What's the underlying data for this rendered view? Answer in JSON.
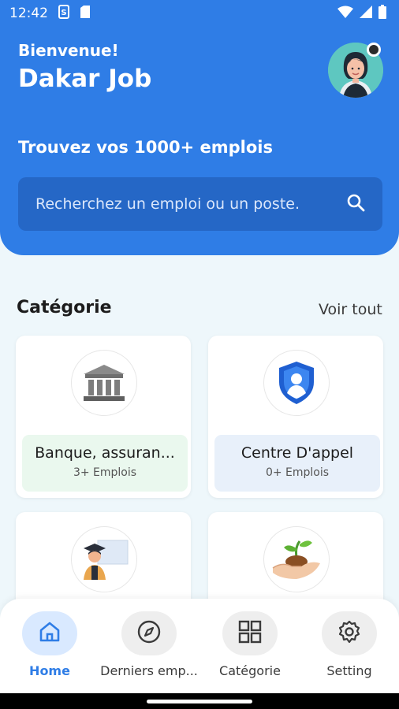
{
  "status_bar": {
    "time": "12:42"
  },
  "header": {
    "welcome": "Bienvenue!",
    "app_title": "Dakar Job",
    "tagline": "Trouvez vos 1000+ emplois",
    "search_placeholder": "Recherchez un emploi ou un poste."
  },
  "categories_section": {
    "title": "Catégorie",
    "see_all": "Voir tout",
    "cards": [
      {
        "name": "Banque, assuran...",
        "count": "3+ Emplois",
        "icon": "bank-icon",
        "bg": "#eaf8ee"
      },
      {
        "name": "Centre D'appel",
        "count": "0+ Emplois",
        "icon": "shield-user-icon",
        "bg": "#e8f0fa"
      },
      {
        "name": "",
        "count": "",
        "icon": "teacher-icon",
        "bg": "#ffffff"
      },
      {
        "name": "",
        "count": "",
        "icon": "plant-hand-icon",
        "bg": "#ffffff"
      }
    ]
  },
  "bottom_nav": {
    "items": [
      {
        "label": "Home",
        "icon": "home-icon",
        "active": true
      },
      {
        "label": "Derniers emp...",
        "icon": "compass-icon",
        "active": false
      },
      {
        "label": "Catégorie",
        "icon": "grid-icon",
        "active": false
      },
      {
        "label": "Setting",
        "icon": "gear-icon",
        "active": false
      }
    ]
  },
  "colors": {
    "primary": "#2f7de6",
    "search_bg": "#2567c6",
    "page_bg": "#eef7fb"
  }
}
